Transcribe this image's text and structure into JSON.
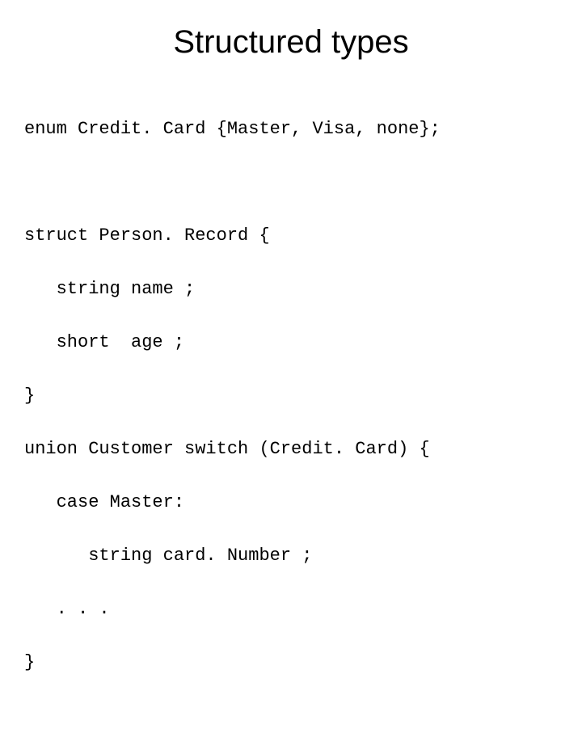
{
  "title": "Structured types",
  "code": {
    "line1": "enum Credit. Card {Master, Visa, none};",
    "line2": "struct Person. Record {",
    "line3": "   string name ;",
    "line4": "   short  age ;",
    "line5": "}",
    "line6": "union Customer switch (Credit. Card) {",
    "line7": "   case Master:",
    "line8": "      string card. Number ;",
    "line9": "   . . .",
    "line10": "}"
  }
}
